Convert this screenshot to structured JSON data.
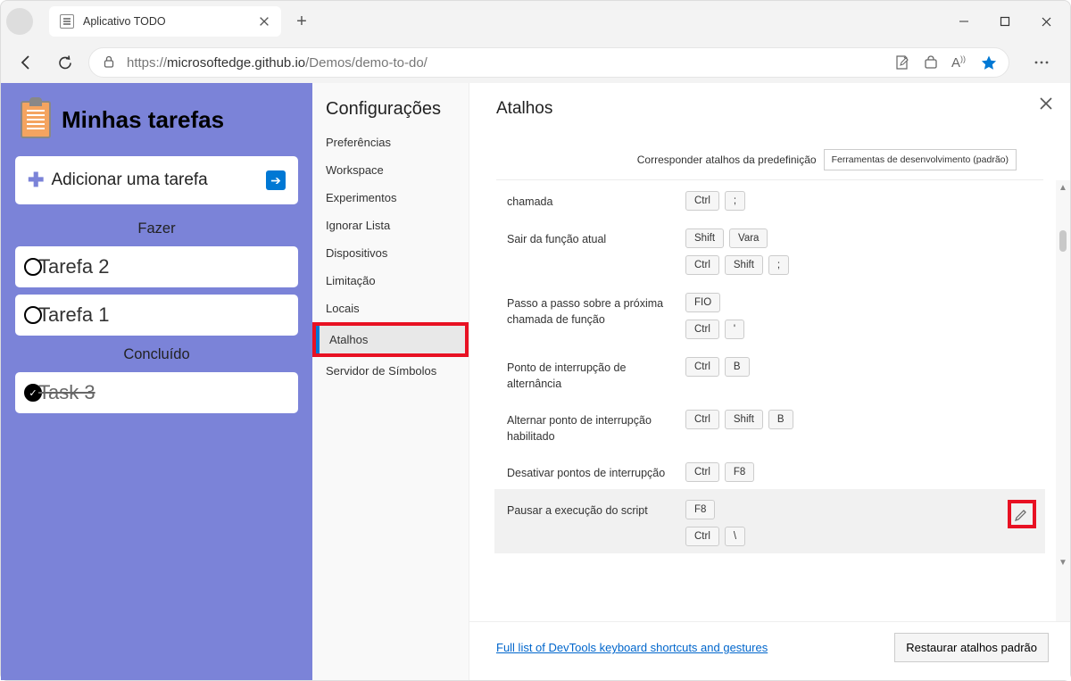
{
  "browser": {
    "tab_title": "Aplicativo TODO",
    "url_host": "microsoftedge.github.io",
    "url_scheme": "https://",
    "url_path": "/Demos/demo-to-do/"
  },
  "app": {
    "title": "Minhas tarefas",
    "add_label": "Adicionar uma tarefa",
    "section_todo": "Fazer",
    "section_done": "Concluído",
    "tasks_todo": [
      "Tarefa 2",
      "Tarefa 1"
    ],
    "tasks_done": [
      "Task 3"
    ]
  },
  "settings": {
    "title": "Configurações",
    "items": [
      "Preferências",
      "Workspace",
      "Experimentos",
      "Ignorar Lista",
      "Dispositivos",
      "Limitação",
      "Locais",
      "Atalhos",
      "Servidor de Símbolos"
    ],
    "active_index": 7
  },
  "shortcuts": {
    "title": "Atalhos",
    "preset_label": "Corresponder atalhos da predefinição",
    "preset_value": "Ferramentas de desenvolvimento (padrão)",
    "footer_link": "Full list of DevTools keyboard shortcuts and gestures",
    "footer_btn": "Restaurar atalhos padrão",
    "rows": [
      {
        "label": "chamada",
        "keys": [
          [
            "Ctrl",
            ";"
          ]
        ]
      },
      {
        "label": "Sair da função atual",
        "keys": [
          [
            "Shift",
            "Vara"
          ],
          [
            "Ctrl",
            "Shift",
            ";"
          ]
        ]
      },
      {
        "label": "Passo a passo sobre a próxima chamada de função",
        "keys": [
          [
            "FIO"
          ],
          [
            "Ctrl",
            "'"
          ]
        ]
      },
      {
        "label": "Ponto de interrupção de alternância",
        "keys": [
          [
            "Ctrl",
            "B"
          ]
        ]
      },
      {
        "label": "Alternar ponto de interrupção habilitado",
        "keys": [
          [
            "Ctrl",
            "Shift",
            "B"
          ]
        ]
      },
      {
        "label": "Desativar pontos de interrupção",
        "keys": [
          [
            "Ctrl",
            "F8"
          ]
        ]
      },
      {
        "label": "Pausar a execução do script",
        "keys": [
          [
            "F8"
          ],
          [
            "Ctrl",
            "\\"
          ]
        ],
        "highlighted": true,
        "editable": true
      }
    ]
  }
}
